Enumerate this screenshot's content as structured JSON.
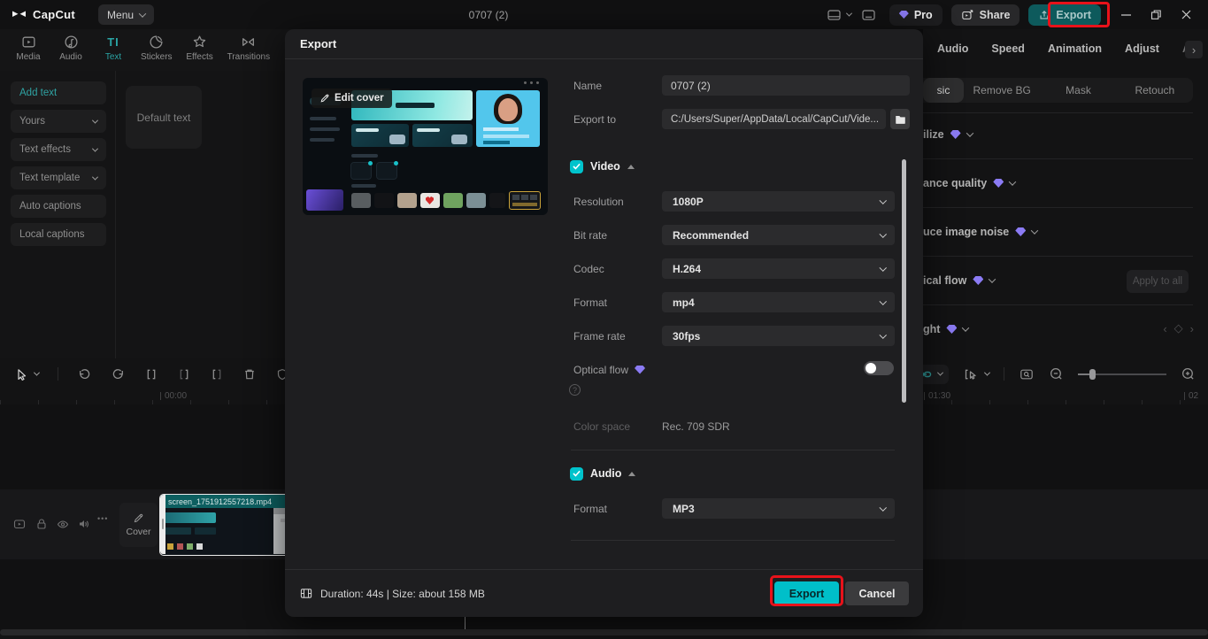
{
  "topbar": {
    "logo": "CapCut",
    "menu_label": "Menu",
    "project_title": "0707 (2)",
    "pro_label": "Pro",
    "share_label": "Share",
    "export_label": "Export"
  },
  "media_tabs": {
    "media": "Media",
    "audio": "Audio",
    "text": "Text",
    "stickers": "Stickers",
    "effects": "Effects",
    "transitions": "Transitions"
  },
  "text_panel": {
    "add_text": "Add text",
    "yours": "Yours",
    "text_effects": "Text effects",
    "text_template": "Text template",
    "auto_captions": "Auto captions",
    "local_captions": "Local captions",
    "default_card": "Default text"
  },
  "right_panel": {
    "tabs": [
      "Audio",
      "Speed",
      "Animation",
      "Adjust",
      "A"
    ],
    "next_tab": "›",
    "subtabs": [
      "sic",
      "Remove BG",
      "Mask",
      "Retouch"
    ],
    "rows": [
      "ilize",
      "ance quality",
      "uce image noise",
      "ical flow",
      "ght"
    ],
    "apply_to_all": "Apply to all",
    "keyframe_prev": "‹",
    "keyframe_diamond": "◇",
    "keyframe_next": "›"
  },
  "dialog": {
    "title": "Export",
    "edit_cover": "Edit cover",
    "name_label": "Name",
    "name_value": "0707 (2)",
    "export_to_label": "Export to",
    "export_to_value": "C:/Users/Super/AppData/Local/CapCut/Vide...",
    "video_section": "Video",
    "fields": [
      {
        "label": "Resolution",
        "value": "1080P"
      },
      {
        "label": "Bit rate",
        "value": "Recommended"
      },
      {
        "label": "Codec",
        "value": "H.264"
      },
      {
        "label": "Format",
        "value": "mp4"
      },
      {
        "label": "Frame rate",
        "value": "30fps"
      }
    ],
    "optical_flow_label": "Optical flow",
    "help_glyph": "?",
    "color_space_label": "Color space",
    "color_space_value": "Rec. 709 SDR",
    "audio_section": "Audio",
    "audio_format_label": "Format",
    "audio_format_value": "MP3",
    "footer_info": "Duration: 44s | Size: about 158 MB",
    "export_button": "Export",
    "cancel_button": "Cancel"
  },
  "timeline": {
    "ruler_start": "00:00",
    "ruler_mid": "01:30",
    "ruler_end": "02",
    "cover_label": "Cover",
    "clip_name": "screen_1751912557218.mp4",
    "more_glyph": "•••"
  },
  "colors": {
    "accent_teal": "#00c3cc",
    "pro_purple": "#8b7bf4",
    "highlight_red": "#e8121a",
    "export_button_teal": "#00bfc9"
  }
}
